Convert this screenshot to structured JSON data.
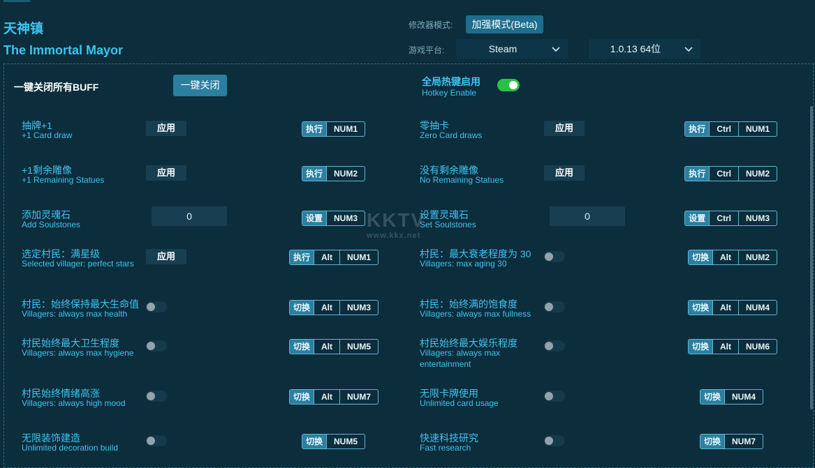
{
  "header": {
    "title_cn": "天神镇",
    "title_en": "The Immortal Mayor",
    "mode_label": "修改器模式:",
    "mode_value": "加强模式(Beta)",
    "platform_label": "游戏平台:",
    "platform_value": "Steam",
    "version_value": "1.0.13 64位"
  },
  "global": {
    "close_all_label": "一键关闭所有BUFF",
    "close_all_button": "一键关闭",
    "hotkey_cn": "全局热键启用",
    "hotkey_en": "Hotkey Enable",
    "hotkey_enabled": true
  },
  "colors": {
    "accent": "#3fc3ef",
    "background": "#0c2d3c",
    "toggle_on": "#27c245"
  },
  "features": [
    {
      "cn": "抽牌+1",
      "en": "+1 Card draw",
      "control": "button",
      "control_label": "应用",
      "hotkey": {
        "action": "执行",
        "keys": [
          "NUM1"
        ]
      }
    },
    {
      "cn": "零抽卡",
      "en": "Zero Card draws",
      "control": "button",
      "control_label": "应用",
      "hotkey": {
        "action": "执行",
        "keys": [
          "Ctrl",
          "NUM1"
        ]
      }
    },
    {
      "cn": "+1剩余雕像",
      "en": "+1 Remaining Statues",
      "control": "button",
      "control_label": "应用",
      "hotkey": {
        "action": "执行",
        "keys": [
          "NUM2"
        ]
      }
    },
    {
      "cn": "没有剩余雕像",
      "en": "No Remaining Statues",
      "control": "button",
      "control_label": "应用",
      "hotkey": {
        "action": "执行",
        "keys": [
          "Ctrl",
          "NUM2"
        ]
      }
    },
    {
      "cn": "添加灵魂石",
      "en": "Add Soulstones",
      "control": "input",
      "control_label": "0",
      "hotkey": {
        "action": "设置",
        "keys": [
          "NUM3"
        ]
      }
    },
    {
      "cn": "设置灵魂石",
      "en": "Set Soulstones",
      "control": "input",
      "control_label": "0",
      "hotkey": {
        "action": "设置",
        "keys": [
          "Ctrl",
          "NUM3"
        ]
      }
    },
    {
      "cn": "选定村民：满星级",
      "en": "Selected villager: perfect stars",
      "control": "button",
      "control_label": "应用",
      "hotkey": {
        "action": "执行",
        "keys": [
          "Alt",
          "NUM1"
        ]
      }
    },
    {
      "cn": "村民：最大衰老程度为 30",
      "en": "Villagers: max aging 30",
      "control": "toggle",
      "hotkey": {
        "action": "切换",
        "keys": [
          "Alt",
          "NUM2"
        ]
      }
    },
    {
      "cn": "村民：始终保持最大生命值",
      "en": "Villagers: always max health",
      "control": "toggle",
      "hotkey": {
        "action": "切换",
        "keys": [
          "Alt",
          "NUM3"
        ]
      }
    },
    {
      "cn": "村民：始终满的饱食度",
      "en": "Villagers: always max fullness",
      "control": "toggle",
      "hotkey": {
        "action": "切换",
        "keys": [
          "Alt",
          "NUM4"
        ]
      }
    },
    {
      "cn": "村民始终最大卫生程度",
      "en": "Villagers: always max hygiene",
      "control": "toggle",
      "hotkey": {
        "action": "切换",
        "keys": [
          "Alt",
          "NUM5"
        ]
      }
    },
    {
      "cn": "村民始终最大娱乐程度",
      "en": "Villagers: always max entertainment",
      "control": "toggle",
      "hotkey": {
        "action": "切换",
        "keys": [
          "Alt",
          "NUM6"
        ]
      }
    },
    {
      "cn": "村民始终情绪高涨",
      "en": "Villagers: always high mood",
      "control": "toggle",
      "hotkey": {
        "action": "切换",
        "keys": [
          "Alt",
          "NUM7"
        ]
      }
    },
    {
      "cn": "无限卡牌使用",
      "en": "Unlimited card usage",
      "control": "toggle",
      "hotkey": {
        "action": "切换",
        "keys": [
          "NUM4"
        ]
      }
    },
    {
      "cn": "无限装饰建造",
      "en": "Unlimited decoration build",
      "control": "toggle",
      "hotkey": {
        "action": "切换",
        "keys": [
          "NUM5"
        ]
      }
    },
    {
      "cn": "快速科技研究",
      "en": "Fast research",
      "control": "toggle",
      "hotkey": {
        "action": "切换",
        "keys": [
          "NUM7"
        ]
      }
    }
  ],
  "watermark": {
    "logo": "KKTV",
    "url": "www.kkx.net"
  }
}
